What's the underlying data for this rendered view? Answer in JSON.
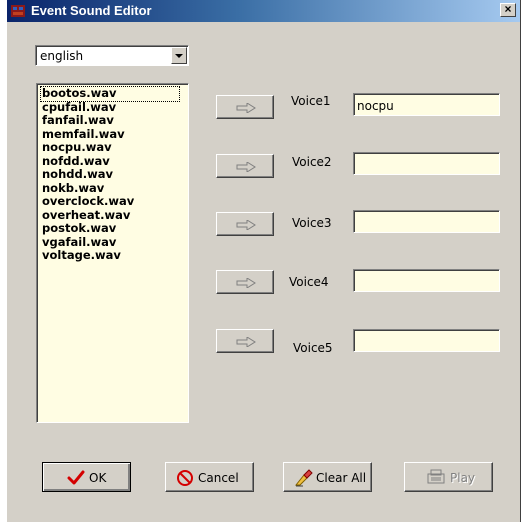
{
  "window": {
    "title": "Event Sound Editor",
    "close_glyph": "×"
  },
  "language": {
    "selected": "english"
  },
  "files": [
    "bootos.wav",
    "cpufail.wav",
    "fanfail.wav",
    "memfail.wav",
    "nocpu.wav",
    "nofdd.wav",
    "nohdd.wav",
    "nokb.wav",
    "overclock.wav",
    "overheat.wav",
    "postok.wav",
    "vgafail.wav",
    "voltage.wav"
  ],
  "voices": [
    {
      "label": "Voice1",
      "value": "nocpu"
    },
    {
      "label": "Voice2",
      "value": ""
    },
    {
      "label": "Voice3",
      "value": ""
    },
    {
      "label": "Voice4",
      "value": ""
    },
    {
      "label": "Voice5",
      "value": ""
    }
  ],
  "buttons": {
    "ok": "OK",
    "cancel": "Cancel",
    "clear_all": "Clear All",
    "play": "Play"
  },
  "icons": {
    "app": "app-icon",
    "assign_arrow": "right-arrow-icon",
    "ok": "checkmark-icon",
    "cancel": "no-entry-icon",
    "clear_all": "eraser-icon",
    "play": "play-icon"
  },
  "colors": {
    "title_start": "#0a246a",
    "title_end": "#a6caf0",
    "face": "#d4d0c8",
    "field_bg": "#fffde3",
    "ok_check": "#d40000",
    "cancel_icon": "#d40000"
  }
}
